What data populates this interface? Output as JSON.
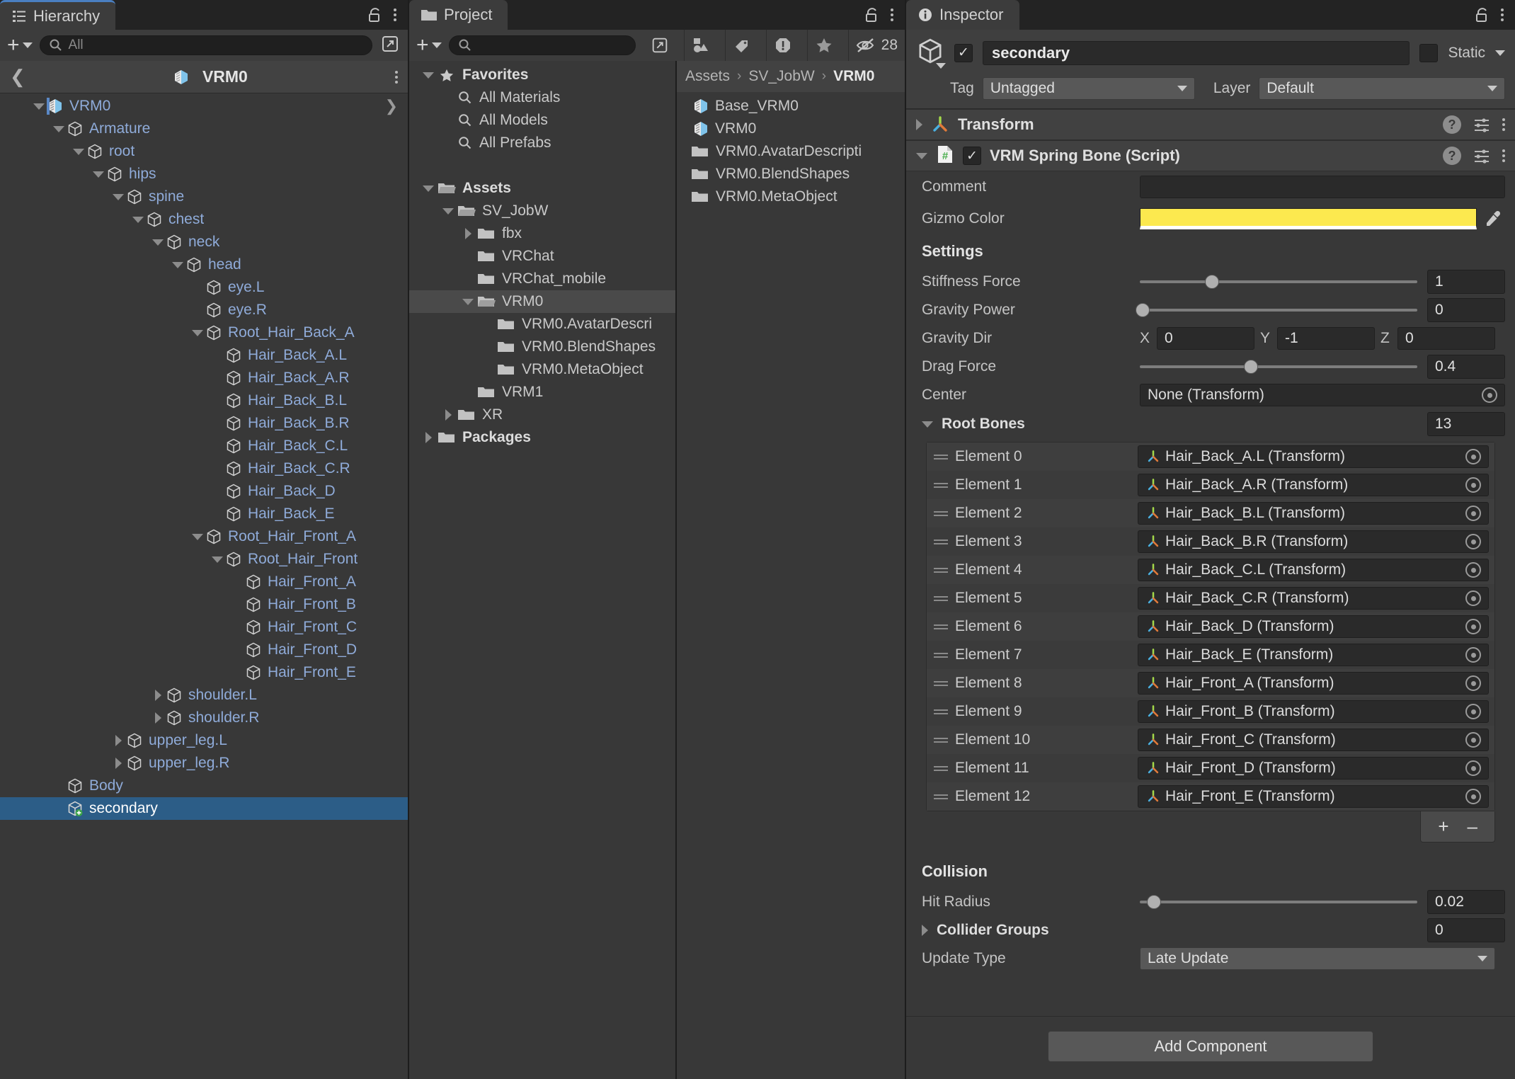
{
  "hierarchy": {
    "tab_label": "Hierarchy",
    "lock_icon": "lock-icon",
    "menu_icon": "kebab-menu-icon",
    "add_label": "+",
    "search_placeholder": "All",
    "search_value": "",
    "breadcrumb_title": "VRM0",
    "back_icon": "chevron-left-icon",
    "rows": [
      {
        "label": "VRM0",
        "depth": 1,
        "twist": "down",
        "icon": "prefab-cube-icon",
        "selected": false
      },
      {
        "label": "Armature",
        "depth": 2,
        "twist": "down",
        "icon": "gameobject-cube-icon",
        "selected": false
      },
      {
        "label": "root",
        "depth": 3,
        "twist": "down",
        "icon": "gameobject-cube-icon",
        "selected": false
      },
      {
        "label": "hips",
        "depth": 4,
        "twist": "down",
        "icon": "gameobject-cube-icon",
        "selected": false
      },
      {
        "label": "spine",
        "depth": 5,
        "twist": "down",
        "icon": "gameobject-cube-icon",
        "selected": false
      },
      {
        "label": "chest",
        "depth": 6,
        "twist": "down",
        "icon": "gameobject-cube-icon",
        "selected": false
      },
      {
        "label": "neck",
        "depth": 7,
        "twist": "down",
        "icon": "gameobject-cube-icon",
        "selected": false
      },
      {
        "label": "head",
        "depth": 8,
        "twist": "down",
        "icon": "gameobject-cube-icon",
        "selected": false
      },
      {
        "label": "eye.L",
        "depth": 9,
        "twist": "none",
        "icon": "gameobject-cube-icon",
        "selected": false
      },
      {
        "label": "eye.R",
        "depth": 9,
        "twist": "none",
        "icon": "gameobject-cube-icon",
        "selected": false
      },
      {
        "label": "Root_Hair_Back_A",
        "depth": 9,
        "twist": "down",
        "icon": "gameobject-cube-icon",
        "selected": false
      },
      {
        "label": "Hair_Back_A.L",
        "depth": 10,
        "twist": "none",
        "icon": "gameobject-cube-icon",
        "selected": false
      },
      {
        "label": "Hair_Back_A.R",
        "depth": 10,
        "twist": "none",
        "icon": "gameobject-cube-icon",
        "selected": false
      },
      {
        "label": "Hair_Back_B.L",
        "depth": 10,
        "twist": "none",
        "icon": "gameobject-cube-icon",
        "selected": false
      },
      {
        "label": "Hair_Back_B.R",
        "depth": 10,
        "twist": "none",
        "icon": "gameobject-cube-icon",
        "selected": false
      },
      {
        "label": "Hair_Back_C.L",
        "depth": 10,
        "twist": "none",
        "icon": "gameobject-cube-icon",
        "selected": false
      },
      {
        "label": "Hair_Back_C.R",
        "depth": 10,
        "twist": "none",
        "icon": "gameobject-cube-icon",
        "selected": false
      },
      {
        "label": "Hair_Back_D",
        "depth": 10,
        "twist": "none",
        "icon": "gameobject-cube-icon",
        "selected": false
      },
      {
        "label": "Hair_Back_E",
        "depth": 10,
        "twist": "none",
        "icon": "gameobject-cube-icon",
        "selected": false
      },
      {
        "label": "Root_Hair_Front_A",
        "depth": 9,
        "twist": "down",
        "icon": "gameobject-cube-icon",
        "selected": false
      },
      {
        "label": "Root_Hair_Front",
        "depth": 10,
        "twist": "down",
        "icon": "gameobject-cube-icon",
        "selected": false
      },
      {
        "label": "Hair_Front_A",
        "depth": 11,
        "twist": "none",
        "icon": "gameobject-cube-icon",
        "selected": false
      },
      {
        "label": "Hair_Front_B",
        "depth": 11,
        "twist": "none",
        "icon": "gameobject-cube-icon",
        "selected": false
      },
      {
        "label": "Hair_Front_C",
        "depth": 11,
        "twist": "none",
        "icon": "gameobject-cube-icon",
        "selected": false
      },
      {
        "label": "Hair_Front_D",
        "depth": 11,
        "twist": "none",
        "icon": "gameobject-cube-icon",
        "selected": false
      },
      {
        "label": "Hair_Front_E",
        "depth": 11,
        "twist": "none",
        "icon": "gameobject-cube-icon",
        "selected": false
      },
      {
        "label": "shoulder.L",
        "depth": 7,
        "twist": "right",
        "icon": "gameobject-cube-icon",
        "selected": false
      },
      {
        "label": "shoulder.R",
        "depth": 7,
        "twist": "right",
        "icon": "gameobject-cube-icon",
        "selected": false
      },
      {
        "label": "upper_leg.L",
        "depth": 5,
        "twist": "right",
        "icon": "gameobject-cube-icon",
        "selected": false
      },
      {
        "label": "upper_leg.R",
        "depth": 5,
        "twist": "right",
        "icon": "gameobject-cube-icon",
        "selected": false
      },
      {
        "label": "Body",
        "depth": 2,
        "twist": "none",
        "icon": "gameobject-cube-icon",
        "selected": false
      },
      {
        "label": "secondary",
        "depth": 2,
        "twist": "none",
        "icon": "gameobject-script-cube-icon",
        "selected": true
      }
    ]
  },
  "project": {
    "tab_label": "Project",
    "folder_tab_icon": "folder-icon",
    "lock_icon": "lock-icon",
    "menu_icon": "kebab-menu-icon",
    "add_label": "+",
    "search_placeholder": "",
    "search_value": "",
    "toolbar_icons": [
      {
        "name": "save-search-icon",
        "glyph": "shapes"
      },
      {
        "name": "label-tag-icon",
        "glyph": "tag"
      },
      {
        "name": "warning-octagon-icon",
        "glyph": "warn"
      },
      {
        "name": "favorite-star-icon",
        "glyph": "star"
      }
    ],
    "hidden_count": "28",
    "hidden_icon": "eye-off-icon",
    "tree": [
      {
        "label": "Favorites",
        "depth": 0,
        "twist": "down",
        "icon": "star-icon",
        "bold": true,
        "selected": false
      },
      {
        "label": "All Materials",
        "depth": 1,
        "twist": "none",
        "icon": "search-icon",
        "bold": false,
        "selected": false
      },
      {
        "label": "All Models",
        "depth": 1,
        "twist": "none",
        "icon": "search-icon",
        "bold": false,
        "selected": false
      },
      {
        "label": "All Prefabs",
        "depth": 1,
        "twist": "none",
        "icon": "search-icon",
        "bold": false,
        "selected": false
      },
      {
        "label": "",
        "depth": 0,
        "twist": "none",
        "icon": "none",
        "bold": false,
        "selected": false
      },
      {
        "label": "Assets",
        "depth": 0,
        "twist": "down",
        "icon": "folder-open-icon",
        "bold": true,
        "selected": false
      },
      {
        "label": "SV_JobW",
        "depth": 1,
        "twist": "down",
        "icon": "folder-open-icon",
        "bold": false,
        "selected": false
      },
      {
        "label": "fbx",
        "depth": 2,
        "twist": "right",
        "icon": "folder-icon",
        "bold": false,
        "selected": false
      },
      {
        "label": "VRChat",
        "depth": 2,
        "twist": "none",
        "icon": "folder-icon",
        "bold": false,
        "selected": false
      },
      {
        "label": "VRChat_mobile",
        "depth": 2,
        "twist": "none",
        "icon": "folder-icon",
        "bold": false,
        "selected": false
      },
      {
        "label": "VRM0",
        "depth": 2,
        "twist": "down",
        "icon": "folder-open-icon",
        "bold": false,
        "selected": true
      },
      {
        "label": "VRM0.AvatarDescri",
        "depth": 3,
        "twist": "none",
        "icon": "folder-icon",
        "bold": false,
        "selected": false
      },
      {
        "label": "VRM0.BlendShapes",
        "depth": 3,
        "twist": "none",
        "icon": "folder-icon",
        "bold": false,
        "selected": false
      },
      {
        "label": "VRM0.MetaObject",
        "depth": 3,
        "twist": "none",
        "icon": "folder-icon",
        "bold": false,
        "selected": false
      },
      {
        "label": "VRM1",
        "depth": 2,
        "twist": "none",
        "icon": "folder-icon",
        "bold": false,
        "selected": false
      },
      {
        "label": "XR",
        "depth": 1,
        "twist": "right",
        "icon": "folder-icon",
        "bold": false,
        "selected": false
      },
      {
        "label": "Packages",
        "depth": 0,
        "twist": "right",
        "icon": "folder-icon",
        "bold": true,
        "selected": false
      }
    ],
    "breadcrumb": [
      "Assets",
      "SV_JobW",
      "VRM0"
    ],
    "files": [
      {
        "label": "Base_VRM0",
        "icon": "prefab-cube-icon"
      },
      {
        "label": "VRM0",
        "icon": "prefab-cube-icon"
      },
      {
        "label": "VRM0.AvatarDescripti",
        "icon": "folder-icon"
      },
      {
        "label": "VRM0.BlendShapes",
        "icon": "folder-icon"
      },
      {
        "label": "VRM0.MetaObject",
        "icon": "folder-icon"
      }
    ]
  },
  "inspector": {
    "tab_label": "Inspector",
    "tab_icon": "info-icon",
    "lock_icon": "lock-icon",
    "menu_icon": "kebab-menu-icon",
    "object_enabled": true,
    "object_name": "secondary",
    "static_label": "Static",
    "static_checked": false,
    "tag_label": "Tag",
    "tag_value": "Untagged",
    "layer_label": "Layer",
    "layer_value": "Default",
    "transform": {
      "name": "Transform",
      "icon": "transform-axes-icon",
      "expanded": false
    },
    "spring_bone": {
      "name": "VRM Spring Bone (Script)",
      "icon": "cs-script-icon",
      "enabled": true,
      "expanded": true,
      "comment_label": "Comment",
      "comment_value": "",
      "gizmo_color_label": "Gizmo Color",
      "gizmo_color": "#FCE94F",
      "settings_header": "Settings",
      "stiffness_label": "Stiffness Force",
      "stiffness_value": "1",
      "stiffness_pct": 26,
      "gravity_power_label": "Gravity Power",
      "gravity_power_value": "0",
      "gravity_power_pct": 1,
      "gravity_dir_label": "Gravity Dir",
      "gravity_dir": {
        "x": "0",
        "y": "-1",
        "z": "0"
      },
      "drag_force_label": "Drag Force",
      "drag_force_value": "0.4",
      "drag_force_pct": 40,
      "center_label": "Center",
      "center_value": "None (Transform)",
      "root_bones_label": "Root Bones",
      "root_bones_count": "13",
      "elements": [
        {
          "index": "Element 0",
          "value": "Hair_Back_A.L (Transform)"
        },
        {
          "index": "Element 1",
          "value": "Hair_Back_A.R (Transform)"
        },
        {
          "index": "Element 2",
          "value": "Hair_Back_B.L (Transform)"
        },
        {
          "index": "Element 3",
          "value": "Hair_Back_B.R (Transform)"
        },
        {
          "index": "Element 4",
          "value": "Hair_Back_C.L (Transform)"
        },
        {
          "index": "Element 5",
          "value": "Hair_Back_C.R (Transform)"
        },
        {
          "index": "Element 6",
          "value": "Hair_Back_D (Transform)"
        },
        {
          "index": "Element 7",
          "value": "Hair_Back_E (Transform)"
        },
        {
          "index": "Element 8",
          "value": "Hair_Front_A (Transform)"
        },
        {
          "index": "Element 9",
          "value": "Hair_Front_B (Transform)"
        },
        {
          "index": "Element 10",
          "value": "Hair_Front_C (Transform)"
        },
        {
          "index": "Element 11",
          "value": "Hair_Front_D (Transform)"
        },
        {
          "index": "Element 12",
          "value": "Hair_Front_E (Transform)"
        }
      ],
      "list_add_label": "+",
      "list_remove_label": "–",
      "collision_header": "Collision",
      "hit_radius_label": "Hit Radius",
      "hit_radius_value": "0.02",
      "hit_radius_pct": 5,
      "collider_groups_label": "Collider Groups",
      "collider_groups_count": "0",
      "update_type_label": "Update Type",
      "update_type_value": "Late Update"
    },
    "add_component_label": "Add Component"
  }
}
